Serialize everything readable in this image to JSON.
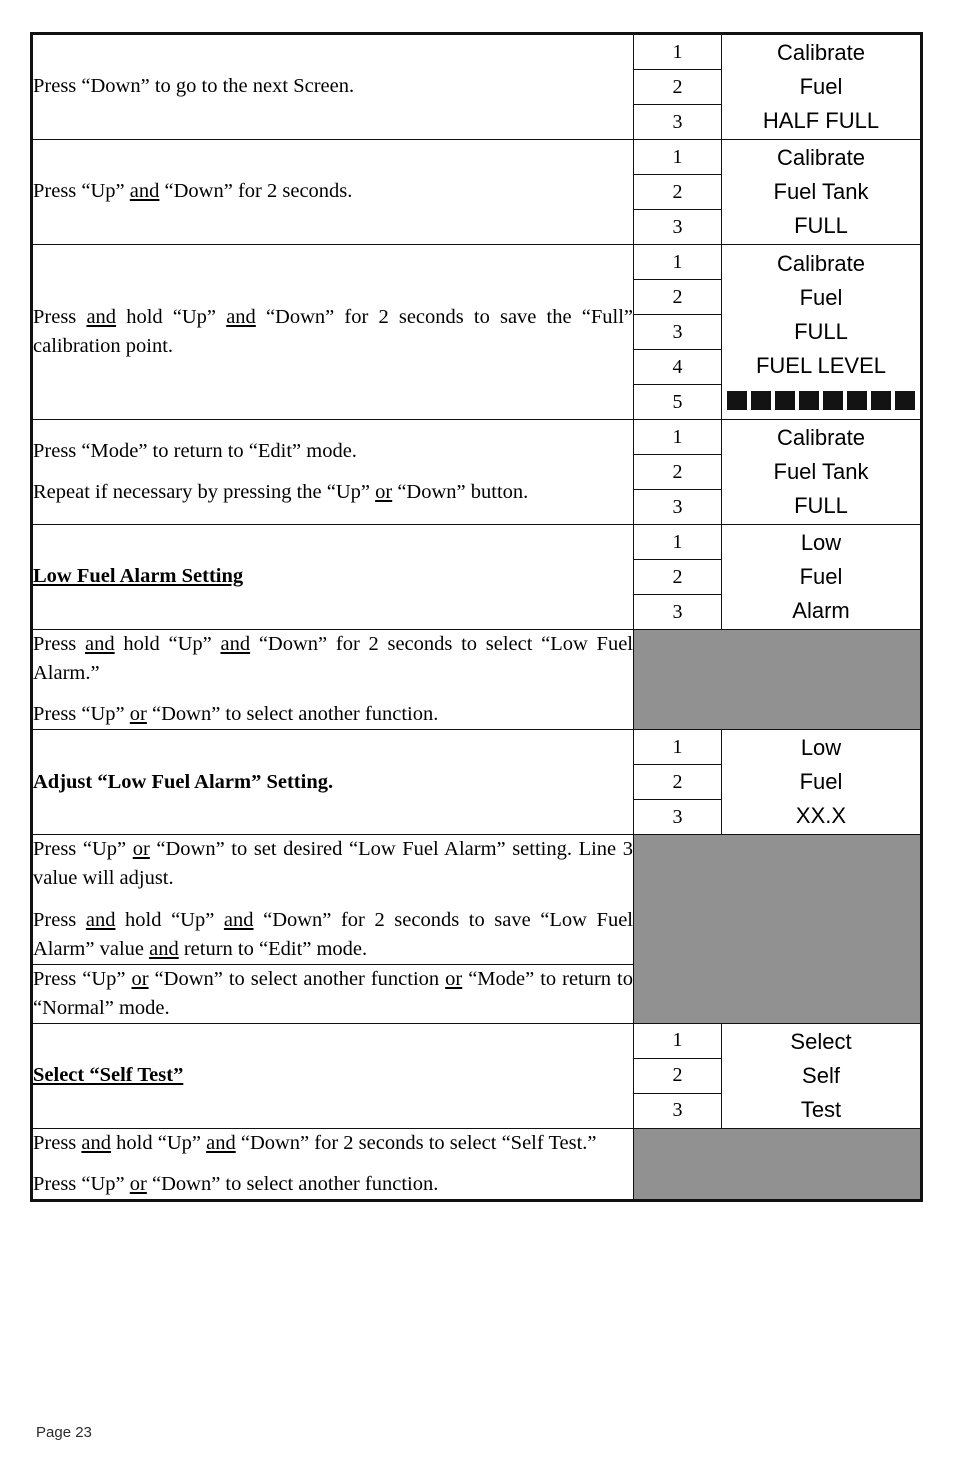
{
  "page": {
    "footer_label": "Page 23",
    "gray_cell_color": "#919191",
    "border_color": "#111111"
  },
  "table": {
    "rows": [
      {
        "instruction_paragraphs": [
          "Press “Down” to go to the next Screen."
        ],
        "heading": null,
        "display": {
          "type": "lines",
          "lines": [
            {
              "number": "1",
              "text": "Calibrate"
            },
            {
              "number": "2",
              "text": "Fuel"
            },
            {
              "number": "3",
              "text": "HALF FULL"
            }
          ]
        }
      },
      {
        "instruction_paragraphs": [
          "Press “Up” and “Down” for 2 seconds."
        ],
        "heading": null,
        "display": {
          "type": "lines",
          "lines": [
            {
              "number": "1",
              "text": "Calibrate"
            },
            {
              "number": "2",
              "text": "Fuel Tank"
            },
            {
              "number": "3",
              "text": "FULL"
            }
          ]
        }
      },
      {
        "instruction_paragraphs": [
          "Press and hold “Up” and “Down” for 2 seconds to save the “Full” calibration point."
        ],
        "heading": null,
        "display": {
          "type": "lines",
          "lines": [
            {
              "number": "1",
              "text": "Calibrate"
            },
            {
              "number": "2",
              "text": "Fuel"
            },
            {
              "number": "3",
              "text": "FULL"
            },
            {
              "number": "4",
              "text": "FUEL LEVEL"
            },
            {
              "number": "5",
              "text": "",
              "bargraph_segments": 8
            }
          ]
        }
      },
      {
        "instruction_paragraphs": [
          "Press “Mode” to return to “Edit” mode.",
          "Repeat if necessary by pressing the “Up” or “Down” button."
        ],
        "heading": null,
        "display": {
          "type": "lines",
          "lines": [
            {
              "number": "1",
              "text": "Calibrate"
            },
            {
              "number": "2",
              "text": "Fuel Tank"
            },
            {
              "number": "3",
              "text": "FULL"
            }
          ]
        }
      },
      {
        "instruction_paragraphs": [],
        "heading": {
          "text": "Low Fuel Alarm Setting",
          "bold": true,
          "underline": true
        },
        "display": {
          "type": "lines",
          "lines": [
            {
              "number": "1",
              "text": "Low"
            },
            {
              "number": "2",
              "text": "Fuel"
            },
            {
              "number": "3",
              "text": "Alarm"
            }
          ]
        }
      },
      {
        "instruction_paragraphs": [
          "Press and hold “Up” and “Down” for 2 seconds to select “Low Fuel Alarm.”",
          "Press “Up” or “Down” to select another function."
        ],
        "heading": null,
        "display": {
          "type": "blank"
        }
      },
      {
        "instruction_paragraphs": [],
        "heading": {
          "text": "Adjust “Low Fuel Alarm” Setting.",
          "bold": true,
          "underline": false
        },
        "display": {
          "type": "lines",
          "lines": [
            {
              "number": "1",
              "text": "Low"
            },
            {
              "number": "2",
              "text": "Fuel"
            },
            {
              "number": "3",
              "text": "XX.X"
            }
          ]
        }
      },
      {
        "instruction_paragraphs": [
          "Press “Up” or “Down” to set desired “Low Fuel Alarm” setting. Line 3 value will adjust.",
          "Press and hold “Up” and “Down” for 2 seconds to save “Low Fuel Alarm” value and return to “Edit” mode."
        ],
        "heading": null,
        "display": {
          "type": "blank",
          "rowspan": 2
        }
      },
      {
        "instruction_paragraphs": [
          "Press “Up” or “Down” to select another function or “Mode” to return to “Normal” mode."
        ],
        "heading": null,
        "display": {
          "type": "spanned"
        }
      },
      {
        "instruction_paragraphs": [],
        "heading": {
          "text": " Select “Self Test”",
          "bold": true,
          "underline": true
        },
        "display": {
          "type": "lines",
          "lines": [
            {
              "number": "1",
              "text": "Select"
            },
            {
              "number": "2",
              "text": "Self"
            },
            {
              "number": "3",
              "text": "Test"
            }
          ]
        }
      },
      {
        "instruction_paragraphs": [
          "Press and hold “Up” and “Down” for 2 seconds to select “Self Test.”",
          "Press “Up” or “Down” to select another function."
        ],
        "heading": null,
        "display": {
          "type": "blank"
        }
      }
    ]
  },
  "underlined_words": [
    "and",
    "or"
  ]
}
